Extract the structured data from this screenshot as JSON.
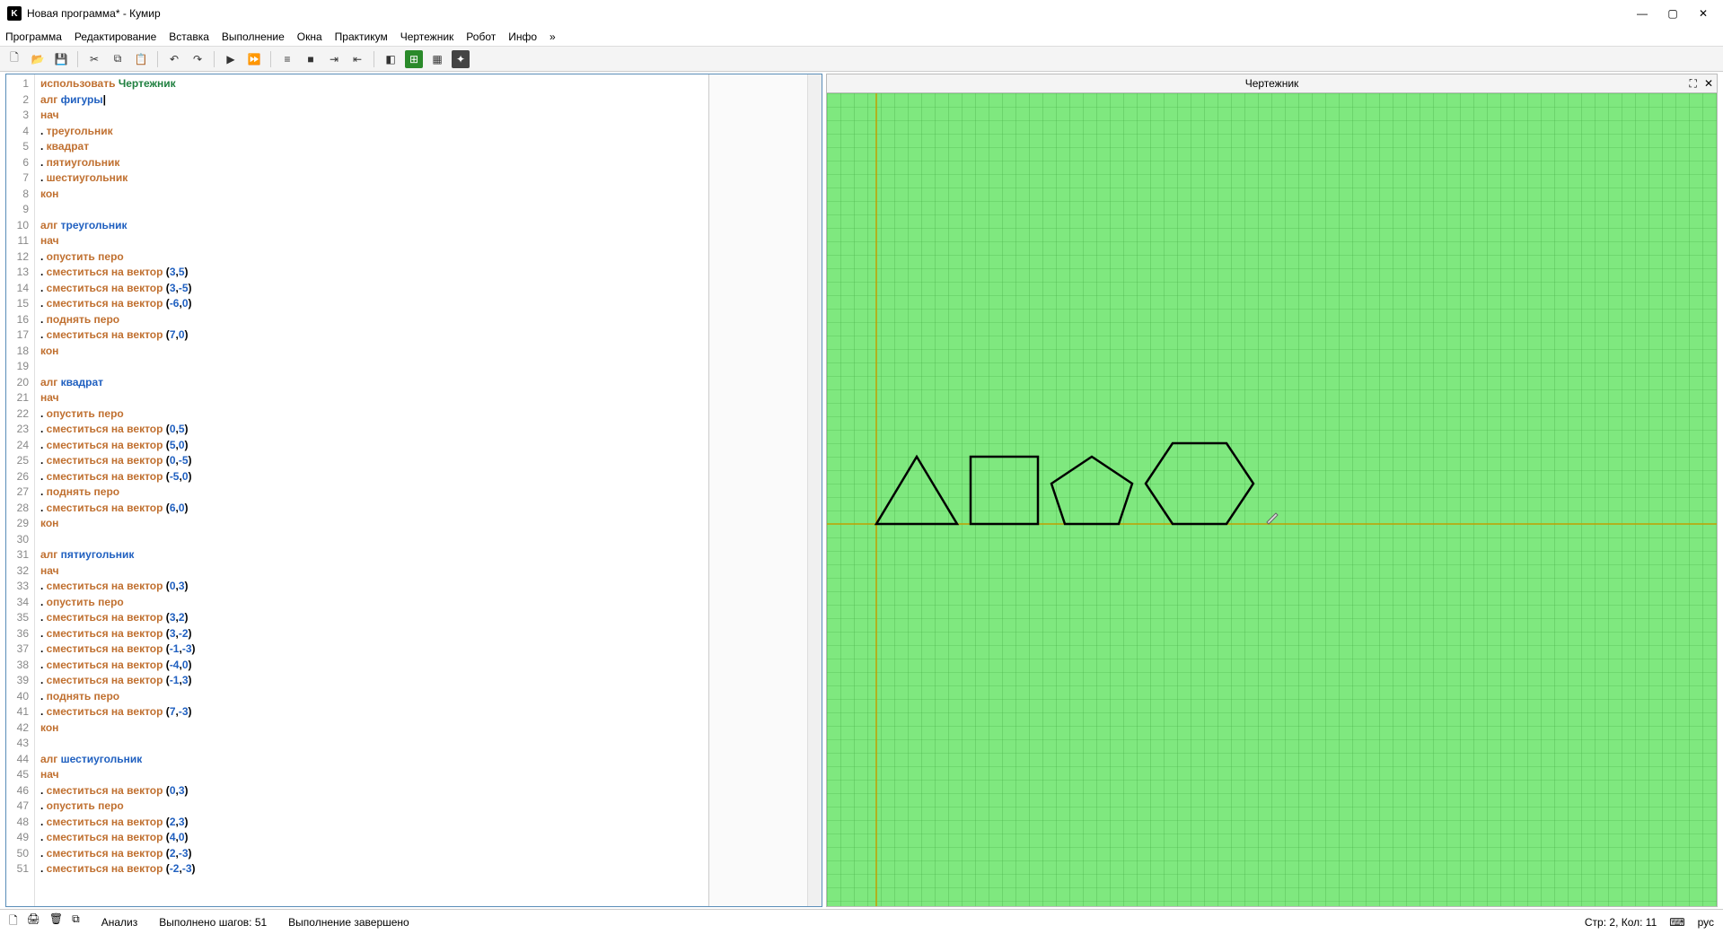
{
  "window": {
    "title": "Новая программа* - Кумир",
    "min_icon": "—",
    "max_icon": "▢",
    "close_icon": "✕"
  },
  "menu": {
    "items": [
      "Программа",
      "Редактирование",
      "Вставка",
      "Выполнение",
      "Окна",
      "Практикум",
      "Чертежник",
      "Робот",
      "Инфо",
      "»"
    ]
  },
  "toolbar_icons": [
    "new",
    "open",
    "save",
    "",
    "cut",
    "copy",
    "paste",
    "",
    "undo",
    "redo",
    "",
    "run",
    "run-step",
    "",
    "step-in",
    "step-over",
    "stop",
    "",
    "toggle-1",
    "toggle-2",
    "grid",
    "tool-a"
  ],
  "code": {
    "lines": [
      {
        "n": 1,
        "tokens": [
          {
            "t": "использовать ",
            "c": "kw"
          },
          {
            "t": "Чертежник",
            "c": "str"
          }
        ]
      },
      {
        "n": 2,
        "tokens": [
          {
            "t": "алг ",
            "c": "kw"
          },
          {
            "t": "фигуры",
            "c": "ident"
          },
          {
            "t": "|",
            "c": ""
          }
        ]
      },
      {
        "n": 3,
        "tokens": [
          {
            "t": "нач",
            "c": "kw"
          }
        ]
      },
      {
        "n": 4,
        "tokens": [
          {
            "t": ". ",
            "c": ""
          },
          {
            "t": "треугольник",
            "c": "kw"
          }
        ]
      },
      {
        "n": 5,
        "tokens": [
          {
            "t": ". ",
            "c": ""
          },
          {
            "t": "квадрат",
            "c": "kw"
          }
        ]
      },
      {
        "n": 6,
        "tokens": [
          {
            "t": ". ",
            "c": ""
          },
          {
            "t": "пятиугольник",
            "c": "kw"
          }
        ]
      },
      {
        "n": 7,
        "tokens": [
          {
            "t": ". ",
            "c": ""
          },
          {
            "t": "шестиугольник",
            "c": "kw"
          }
        ]
      },
      {
        "n": 8,
        "tokens": [
          {
            "t": "кон",
            "c": "kw"
          }
        ]
      },
      {
        "n": 9,
        "tokens": []
      },
      {
        "n": 10,
        "tokens": [
          {
            "t": "алг ",
            "c": "kw"
          },
          {
            "t": "треугольник",
            "c": "ident"
          }
        ]
      },
      {
        "n": 11,
        "tokens": [
          {
            "t": "нач",
            "c": "kw"
          }
        ]
      },
      {
        "n": 12,
        "tokens": [
          {
            "t": ". ",
            "c": ""
          },
          {
            "t": "опустить перо",
            "c": "kw"
          }
        ]
      },
      {
        "n": 13,
        "tokens": [
          {
            "t": ". ",
            "c": ""
          },
          {
            "t": "сместиться на вектор",
            "c": "kw"
          },
          {
            "t": " (",
            "c": ""
          },
          {
            "t": "3",
            "c": "num"
          },
          {
            "t": ",",
            "c": ""
          },
          {
            "t": "5",
            "c": "num"
          },
          {
            "t": ")",
            "c": ""
          }
        ]
      },
      {
        "n": 14,
        "tokens": [
          {
            "t": ". ",
            "c": ""
          },
          {
            "t": "сместиться на вектор",
            "c": "kw"
          },
          {
            "t": " (",
            "c": ""
          },
          {
            "t": "3",
            "c": "num"
          },
          {
            "t": ",",
            "c": ""
          },
          {
            "t": "-5",
            "c": "num"
          },
          {
            "t": ")",
            "c": ""
          }
        ]
      },
      {
        "n": 15,
        "tokens": [
          {
            "t": ". ",
            "c": ""
          },
          {
            "t": "сместиться на вектор",
            "c": "kw"
          },
          {
            "t": " (",
            "c": ""
          },
          {
            "t": "-6",
            "c": "num"
          },
          {
            "t": ",",
            "c": ""
          },
          {
            "t": "0",
            "c": "num"
          },
          {
            "t": ")",
            "c": ""
          }
        ]
      },
      {
        "n": 16,
        "tokens": [
          {
            "t": ". ",
            "c": ""
          },
          {
            "t": "поднять перо",
            "c": "kw"
          }
        ]
      },
      {
        "n": 17,
        "tokens": [
          {
            "t": ". ",
            "c": ""
          },
          {
            "t": "сместиться на вектор",
            "c": "kw"
          },
          {
            "t": " (",
            "c": ""
          },
          {
            "t": "7",
            "c": "num"
          },
          {
            "t": ",",
            "c": ""
          },
          {
            "t": "0",
            "c": "num"
          },
          {
            "t": ")",
            "c": ""
          }
        ]
      },
      {
        "n": 18,
        "tokens": [
          {
            "t": "кон",
            "c": "kw"
          }
        ]
      },
      {
        "n": 19,
        "tokens": []
      },
      {
        "n": 20,
        "tokens": [
          {
            "t": "алг ",
            "c": "kw"
          },
          {
            "t": "квадрат",
            "c": "ident"
          }
        ]
      },
      {
        "n": 21,
        "tokens": [
          {
            "t": "нач",
            "c": "kw"
          }
        ]
      },
      {
        "n": 22,
        "tokens": [
          {
            "t": ". ",
            "c": ""
          },
          {
            "t": "опустить перо",
            "c": "kw"
          }
        ]
      },
      {
        "n": 23,
        "tokens": [
          {
            "t": ". ",
            "c": ""
          },
          {
            "t": "сместиться на вектор",
            "c": "kw"
          },
          {
            "t": " (",
            "c": ""
          },
          {
            "t": "0",
            "c": "num"
          },
          {
            "t": ",",
            "c": ""
          },
          {
            "t": "5",
            "c": "num"
          },
          {
            "t": ")",
            "c": ""
          }
        ]
      },
      {
        "n": 24,
        "tokens": [
          {
            "t": ". ",
            "c": ""
          },
          {
            "t": "сместиться на вектор",
            "c": "kw"
          },
          {
            "t": " (",
            "c": ""
          },
          {
            "t": "5",
            "c": "num"
          },
          {
            "t": ",",
            "c": ""
          },
          {
            "t": "0",
            "c": "num"
          },
          {
            "t": ")",
            "c": ""
          }
        ]
      },
      {
        "n": 25,
        "tokens": [
          {
            "t": ". ",
            "c": ""
          },
          {
            "t": "сместиться на вектор",
            "c": "kw"
          },
          {
            "t": " (",
            "c": ""
          },
          {
            "t": "0",
            "c": "num"
          },
          {
            "t": ",",
            "c": ""
          },
          {
            "t": "-5",
            "c": "num"
          },
          {
            "t": ")",
            "c": ""
          }
        ]
      },
      {
        "n": 26,
        "tokens": [
          {
            "t": ". ",
            "c": ""
          },
          {
            "t": "сместиться на вектор",
            "c": "kw"
          },
          {
            "t": " (",
            "c": ""
          },
          {
            "t": "-5",
            "c": "num"
          },
          {
            "t": ",",
            "c": ""
          },
          {
            "t": "0",
            "c": "num"
          },
          {
            "t": ")",
            "c": ""
          }
        ]
      },
      {
        "n": 27,
        "tokens": [
          {
            "t": ". ",
            "c": ""
          },
          {
            "t": "поднять перо",
            "c": "kw"
          }
        ]
      },
      {
        "n": 28,
        "tokens": [
          {
            "t": ". ",
            "c": ""
          },
          {
            "t": "сместиться на вектор",
            "c": "kw"
          },
          {
            "t": " (",
            "c": ""
          },
          {
            "t": "6",
            "c": "num"
          },
          {
            "t": ",",
            "c": ""
          },
          {
            "t": "0",
            "c": "num"
          },
          {
            "t": ")",
            "c": ""
          }
        ]
      },
      {
        "n": 29,
        "tokens": [
          {
            "t": "кон",
            "c": "kw"
          }
        ]
      },
      {
        "n": 30,
        "tokens": []
      },
      {
        "n": 31,
        "tokens": [
          {
            "t": "алг ",
            "c": "kw"
          },
          {
            "t": "пятиугольник",
            "c": "ident"
          }
        ]
      },
      {
        "n": 32,
        "tokens": [
          {
            "t": "нач",
            "c": "kw"
          }
        ]
      },
      {
        "n": 33,
        "tokens": [
          {
            "t": ". ",
            "c": ""
          },
          {
            "t": "сместиться на вектор",
            "c": "kw"
          },
          {
            "t": " (",
            "c": ""
          },
          {
            "t": "0",
            "c": "num"
          },
          {
            "t": ",",
            "c": ""
          },
          {
            "t": "3",
            "c": "num"
          },
          {
            "t": ")",
            "c": ""
          }
        ]
      },
      {
        "n": 34,
        "tokens": [
          {
            "t": ". ",
            "c": ""
          },
          {
            "t": "опустить перо",
            "c": "kw"
          }
        ]
      },
      {
        "n": 35,
        "tokens": [
          {
            "t": ". ",
            "c": ""
          },
          {
            "t": "сместиться на вектор",
            "c": "kw"
          },
          {
            "t": " (",
            "c": ""
          },
          {
            "t": "3",
            "c": "num"
          },
          {
            "t": ",",
            "c": ""
          },
          {
            "t": "2",
            "c": "num"
          },
          {
            "t": ")",
            "c": ""
          }
        ]
      },
      {
        "n": 36,
        "tokens": [
          {
            "t": ". ",
            "c": ""
          },
          {
            "t": "сместиться на вектор",
            "c": "kw"
          },
          {
            "t": " (",
            "c": ""
          },
          {
            "t": "3",
            "c": "num"
          },
          {
            "t": ",",
            "c": ""
          },
          {
            "t": "-2",
            "c": "num"
          },
          {
            "t": ")",
            "c": ""
          }
        ]
      },
      {
        "n": 37,
        "tokens": [
          {
            "t": ". ",
            "c": ""
          },
          {
            "t": "сместиться на вектор",
            "c": "kw"
          },
          {
            "t": " (",
            "c": ""
          },
          {
            "t": "-1",
            "c": "num"
          },
          {
            "t": ",",
            "c": ""
          },
          {
            "t": "-3",
            "c": "num"
          },
          {
            "t": ")",
            "c": ""
          }
        ]
      },
      {
        "n": 38,
        "tokens": [
          {
            "t": ". ",
            "c": ""
          },
          {
            "t": "сместиться на вектор",
            "c": "kw"
          },
          {
            "t": " (",
            "c": ""
          },
          {
            "t": "-4",
            "c": "num"
          },
          {
            "t": ",",
            "c": ""
          },
          {
            "t": "0",
            "c": "num"
          },
          {
            "t": ")",
            "c": ""
          }
        ]
      },
      {
        "n": 39,
        "tokens": [
          {
            "t": ". ",
            "c": ""
          },
          {
            "t": "сместиться на вектор",
            "c": "kw"
          },
          {
            "t": " (",
            "c": ""
          },
          {
            "t": "-1",
            "c": "num"
          },
          {
            "t": ",",
            "c": ""
          },
          {
            "t": "3",
            "c": "num"
          },
          {
            "t": ")",
            "c": ""
          }
        ]
      },
      {
        "n": 40,
        "tokens": [
          {
            "t": ". ",
            "c": ""
          },
          {
            "t": "поднять перо",
            "c": "kw"
          }
        ]
      },
      {
        "n": 41,
        "tokens": [
          {
            "t": ". ",
            "c": ""
          },
          {
            "t": "сместиться на вектор",
            "c": "kw"
          },
          {
            "t": " (",
            "c": ""
          },
          {
            "t": "7",
            "c": "num"
          },
          {
            "t": ",",
            "c": ""
          },
          {
            "t": "-3",
            "c": "num"
          },
          {
            "t": ")",
            "c": ""
          }
        ]
      },
      {
        "n": 42,
        "tokens": [
          {
            "t": "кон",
            "c": "kw"
          }
        ]
      },
      {
        "n": 43,
        "tokens": []
      },
      {
        "n": 44,
        "tokens": [
          {
            "t": "алг ",
            "c": "kw"
          },
          {
            "t": "шестиугольник",
            "c": "ident"
          }
        ]
      },
      {
        "n": 45,
        "tokens": [
          {
            "t": "нач",
            "c": "kw"
          }
        ]
      },
      {
        "n": 46,
        "tokens": [
          {
            "t": ". ",
            "c": ""
          },
          {
            "t": "сместиться на вектор",
            "c": "kw"
          },
          {
            "t": " (",
            "c": ""
          },
          {
            "t": "0",
            "c": "num"
          },
          {
            "t": ",",
            "c": ""
          },
          {
            "t": "3",
            "c": "num"
          },
          {
            "t": ")",
            "c": ""
          }
        ]
      },
      {
        "n": 47,
        "tokens": [
          {
            "t": ". ",
            "c": ""
          },
          {
            "t": "опустить перо",
            "c": "kw"
          }
        ]
      },
      {
        "n": 48,
        "tokens": [
          {
            "t": ". ",
            "c": ""
          },
          {
            "t": "сместиться на вектор",
            "c": "kw"
          },
          {
            "t": " (",
            "c": ""
          },
          {
            "t": "2",
            "c": "num"
          },
          {
            "t": ",",
            "c": ""
          },
          {
            "t": "3",
            "c": "num"
          },
          {
            "t": ")",
            "c": ""
          }
        ]
      },
      {
        "n": 49,
        "tokens": [
          {
            "t": ". ",
            "c": ""
          },
          {
            "t": "сместиться на вектор",
            "c": "kw"
          },
          {
            "t": " (",
            "c": ""
          },
          {
            "t": "4",
            "c": "num"
          },
          {
            "t": ",",
            "c": ""
          },
          {
            "t": "0",
            "c": "num"
          },
          {
            "t": ")",
            "c": ""
          }
        ]
      },
      {
        "n": 50,
        "tokens": [
          {
            "t": ". ",
            "c": ""
          },
          {
            "t": "сместиться на вектор",
            "c": "kw"
          },
          {
            "t": " (",
            "c": ""
          },
          {
            "t": "2",
            "c": "num"
          },
          {
            "t": ",",
            "c": ""
          },
          {
            "t": "-3",
            "c": "num"
          },
          {
            "t": ")",
            "c": ""
          }
        ]
      },
      {
        "n": 51,
        "tokens": [
          {
            "t": ". ",
            "c": ""
          },
          {
            "t": "сместиться на вектор",
            "c": "kw"
          },
          {
            "t": " (",
            "c": ""
          },
          {
            "t": "-2",
            "c": "num"
          },
          {
            "t": ",",
            "c": ""
          },
          {
            "t": "-3",
            "c": "num"
          },
          {
            "t": ")",
            "c": ""
          }
        ]
      }
    ]
  },
  "canvas": {
    "title": "Чертежник"
  },
  "status": {
    "analysis_label": "Анализ",
    "steps_label": "Выполнено шагов: 51",
    "run_label": "Выполнение завершено",
    "position_label": "Стр: 2, Кол: 11",
    "lang_label": "рус"
  }
}
